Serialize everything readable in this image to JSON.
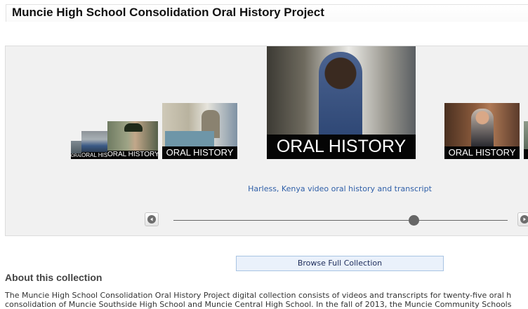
{
  "page": {
    "title": "Muncie High School Consolidation Oral History Project"
  },
  "carousel": {
    "band_text": "ORAL HISTORY",
    "truncated_band_1": "ORAL HIST",
    "truncated_band_2": "ORAL HIS",
    "caption": "Harless, Kenya video oral history and transcript",
    "slider_position": 0.72
  },
  "browse": {
    "label": "Browse Full Collection"
  },
  "about": {
    "heading": "About this collection",
    "paragraph_line1": "The Muncie High School Consolidation Oral History Project digital collection consists of videos and transcripts for twenty-five oral h",
    "paragraph_line2": "consolidation of Muncie Southside High School and Muncie Central High School. In the fall of 2013, the Muncie Community Schools"
  },
  "icons": {
    "prev": "left-arrow-icon",
    "next": "right-arrow-icon"
  }
}
